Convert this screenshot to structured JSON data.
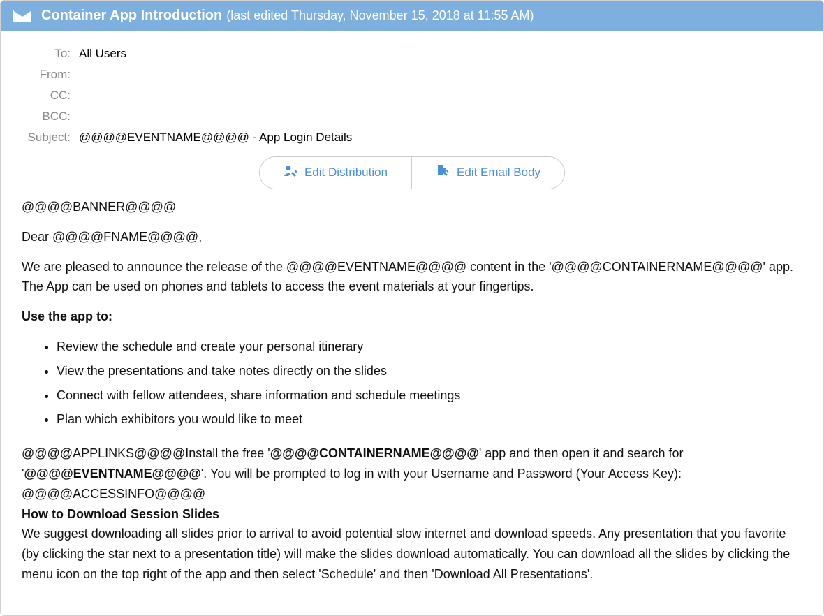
{
  "header": {
    "title": "Container App Introduction",
    "subtitle": "(last edited Thursday, November 15, 2018 at 11:55 AM)"
  },
  "fields": {
    "to_label": "To:",
    "to_value": "All Users",
    "from_label": "From:",
    "from_value": "",
    "cc_label": "CC:",
    "cc_value": "",
    "bcc_label": "BCC:",
    "bcc_value": "",
    "subject_label": "Subject:",
    "subject_value": "@@@@EVENTNAME@@@@ - App Login Details"
  },
  "buttons": {
    "edit_distribution": "Edit Distribution",
    "edit_email_body": "Edit Email Body"
  },
  "body": {
    "banner": "@@@@BANNER@@@@",
    "greeting": "Dear @@@@FNAME@@@@,",
    "intro": "We are pleased to announce the release of the @@@@EVENTNAME@@@@ content in the '@@@@CONTAINERNAME@@@@' app. The App can be used on phones and tablets to access the event materials at your fingertips.",
    "use_heading": "Use the app to:",
    "use_items": [
      "Review the schedule and create your personal itinerary",
      "View the presentations and take notes directly on the slides",
      "Connect with fellow attendees, share information and schedule meetings",
      "Plan which exhibitors you would like to meet"
    ],
    "install_pre": "@@@@APPLINKS@@@@Install the free '",
    "container_bold": "@@@@CONTAINERNAME@@@@",
    "install_mid": "' app and then open it and search for '",
    "eventname_bold": "@@@@EVENTNAME@@@@",
    "install_post": "'.  You will be prompted to log in with your Username and Password (Your Access Key):",
    "accessinfo": "@@@@ACCESSINFO@@@@",
    "download_heading": "How to Download Session Slides",
    "download_text": "We suggest downloading all slides prior to arrival to avoid potential slow internet and download speeds. Any presentation that you favorite (by clicking the star next to a presentation title) will make the slides download automatically.  You can download all the slides by clicking the menu icon on the top right of the app and then select 'Schedule' and then 'Download All Presentations'."
  }
}
